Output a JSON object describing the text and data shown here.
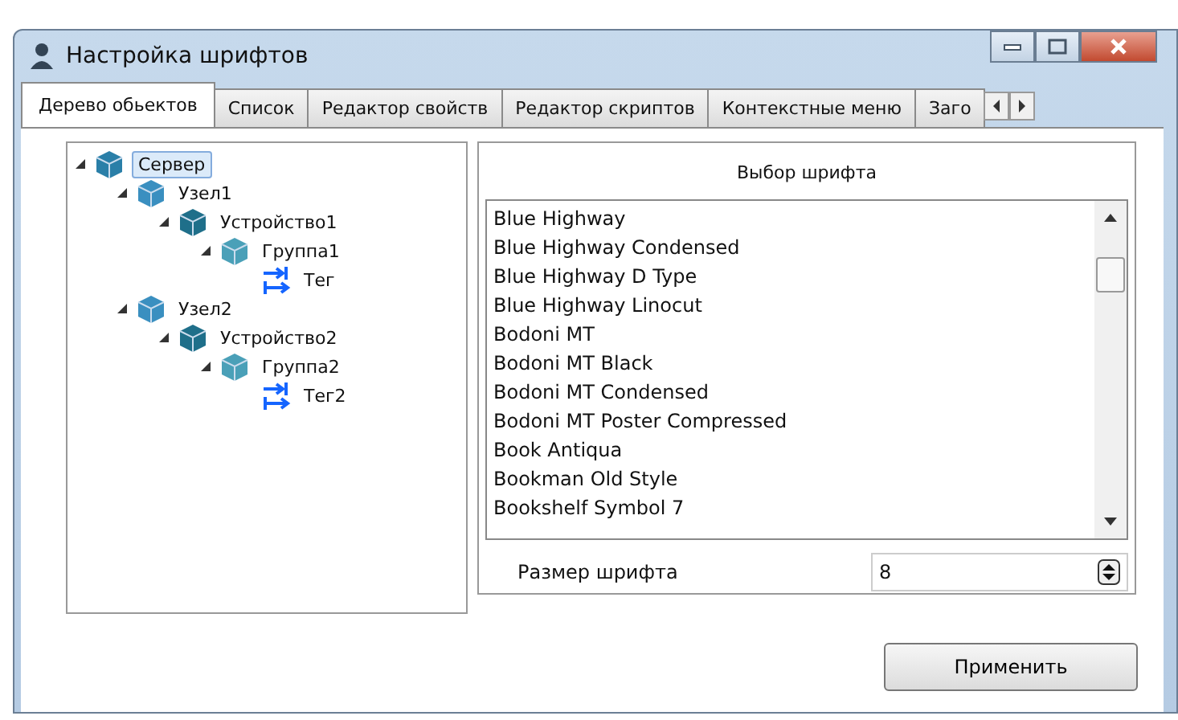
{
  "window": {
    "title": "Настройка шрифтов"
  },
  "tabs": [
    {
      "label": "Дерево обьектов",
      "selected": true
    },
    {
      "label": "Список",
      "selected": false
    },
    {
      "label": "Редактор свойств",
      "selected": false
    },
    {
      "label": "Редактор скриптов",
      "selected": false
    },
    {
      "label": "Контекстные меню",
      "selected": false
    },
    {
      "label": "Заго",
      "selected": false
    }
  ],
  "tree": [
    {
      "label": "Сервер",
      "kind": "server",
      "expanded": true,
      "selected": true,
      "children": [
        {
          "label": "Узел1",
          "kind": "node",
          "expanded": true,
          "selected": false,
          "children": [
            {
              "label": "Устройство1",
              "kind": "device",
              "expanded": true,
              "selected": false,
              "children": [
                {
                  "label": "Группа1",
                  "kind": "group",
                  "expanded": true,
                  "selected": false,
                  "children": [
                    {
                      "label": "Тег",
                      "kind": "tag",
                      "selected": false
                    }
                  ]
                }
              ]
            }
          ]
        },
        {
          "label": "Узел2",
          "kind": "node",
          "expanded": true,
          "selected": false,
          "children": [
            {
              "label": "Устройство2",
              "kind": "device",
              "expanded": true,
              "selected": false,
              "children": [
                {
                  "label": "Группа2",
                  "kind": "group",
                  "expanded": true,
                  "selected": false,
                  "children": [
                    {
                      "label": "Тег2",
                      "kind": "tag",
                      "selected": false
                    }
                  ]
                }
              ]
            }
          ]
        }
      ]
    }
  ],
  "font_panel": {
    "header": "Выбор шрифта",
    "fonts": [
      "Blue Highway",
      "Blue Highway Condensed",
      "Blue Highway D Type",
      "Blue Highway Linocut",
      "Bodoni MT",
      "Bodoni MT Black",
      "Bodoni MT Condensed",
      "Bodoni MT Poster Compressed",
      "Book Antiqua",
      "Bookman Old Style",
      "Bookshelf Symbol 7"
    ],
    "size_label": "Размер шрифта",
    "size_value": "8"
  },
  "apply_button": "Применить"
}
